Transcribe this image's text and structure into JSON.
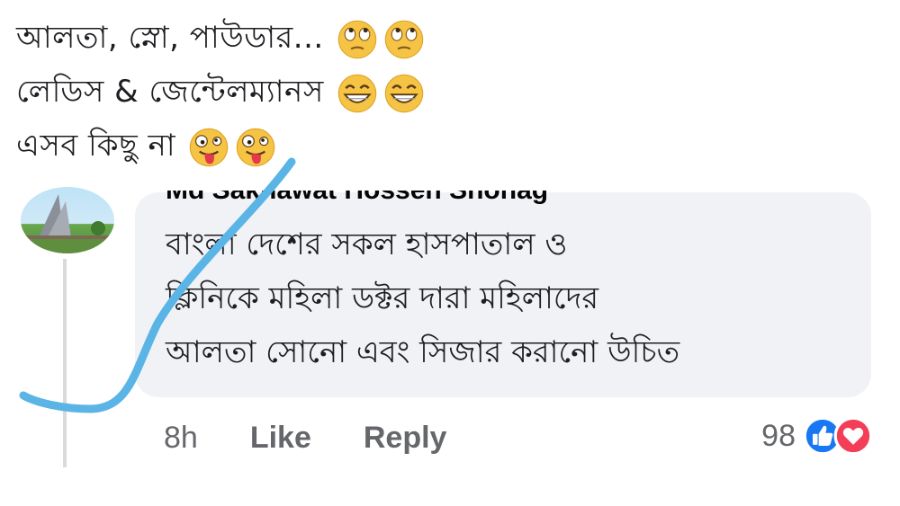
{
  "top_comment": {
    "lines": [
      {
        "text": "আলতা, স্নো, পাউডার...",
        "emojis": [
          "eye-roll-emoji",
          "eye-roll-emoji"
        ]
      },
      {
        "text": "লেডিস & জেন্টেলম্যানস",
        "emojis": [
          "grin-emoji",
          "grin-emoji"
        ]
      },
      {
        "text": "এসব কিছু না",
        "emojis": [
          "tongue-wink-emoji",
          "tongue-wink-emoji"
        ]
      }
    ]
  },
  "reply": {
    "author": "Md Sakhawat Hossen Shohag",
    "lines": [
      "বাংলা দেশের সকল হাসপাতাল ও",
      "ক্লিনিকে মহিলা ডক্টর দারা মহিলাদের",
      "আলতা সোনো এবং সিজার করানো উচিত"
    ],
    "time": "8h",
    "like_label": "Like",
    "reply_label": "Reply",
    "reaction_count": "98",
    "reactions": [
      "like-reaction-icon",
      "love-reaction-icon"
    ]
  },
  "colors": {
    "bubble_bg": "#f0f2f5",
    "annotation_stroke": "#5ab4e5",
    "like_blue": "#1877f2",
    "love_red": "#f33e58"
  }
}
